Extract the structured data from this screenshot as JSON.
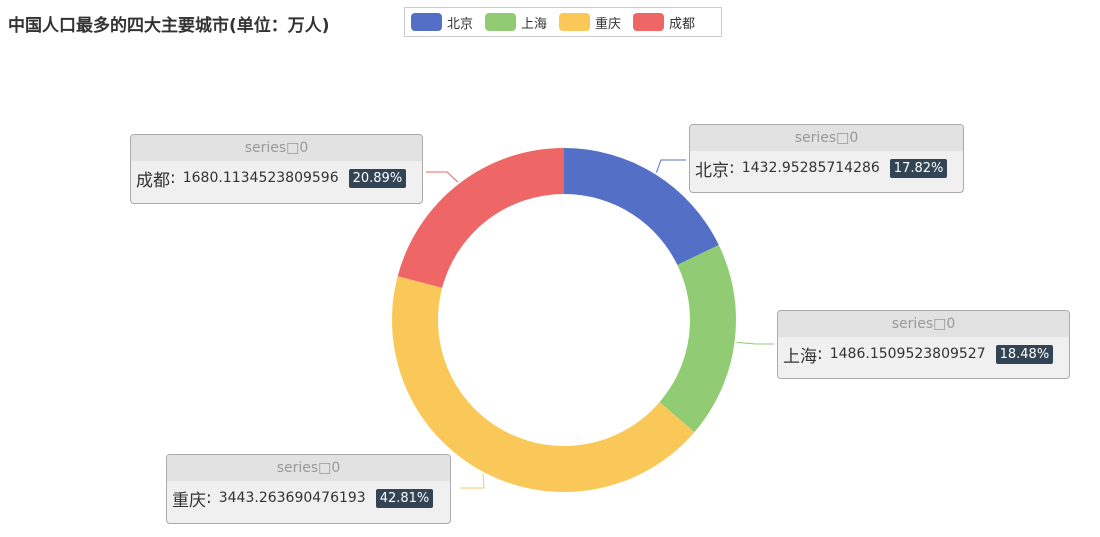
{
  "chart_data": {
    "type": "pie",
    "title": "中国人口最多的四大主要城市(单位：万人)",
    "series_name": "series□0",
    "legend_position": "top",
    "slices": [
      {
        "name": "北京",
        "value": 1432.95285714286,
        "value_text": "1432.95285714286",
        "percent": "17.82%",
        "color": "#5470c6"
      },
      {
        "name": "上海",
        "value": 1486.1509523809527,
        "value_text": "1486.1509523809527",
        "percent": "18.48%",
        "color": "#91cc75"
      },
      {
        "name": "重庆",
        "value": 3443.263690476193,
        "value_text": "3443.263690476193",
        "percent": "42.81%",
        "color": "#fac858"
      },
      {
        "name": "成都",
        "value": 1680.1134523809596,
        "value_text": "1680.1134523809596",
        "percent": "20.89%",
        "color": "#ee6666"
      }
    ]
  }
}
